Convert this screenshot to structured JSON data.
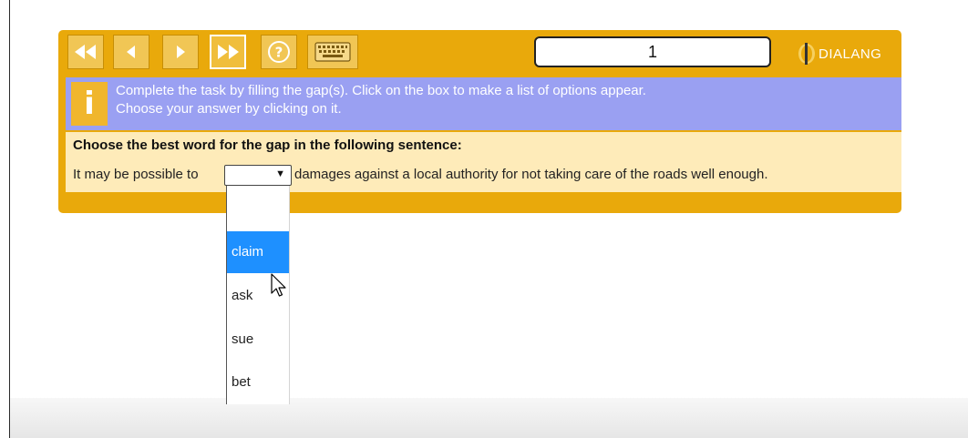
{
  "toolbar": {
    "buttons": [
      {
        "name": "first-page-icon"
      },
      {
        "name": "previous-icon"
      },
      {
        "name": "next-icon"
      },
      {
        "name": "forward-icon"
      },
      {
        "name": "help-icon",
        "glyph": "?"
      },
      {
        "name": "keyboard-icon"
      }
    ],
    "page_number": "1",
    "logo_text": "DIALANG"
  },
  "instruction": {
    "icon_glyph": "i",
    "line1": "Complete the task by filling the gap(s). Click on the box to make a list of options appear.",
    "line2": "Choose your answer by clicking on it."
  },
  "task": {
    "heading": "Choose the best word for the gap in the following sentence:",
    "sentence_before": "It may be possible to",
    "sentence_after": "damages against a local authority for not taking care of the roads well enough.",
    "select_arrow": "▼",
    "options": [
      "",
      "claim",
      "ask",
      "sue",
      "bet"
    ],
    "highlighted_option": "claim"
  },
  "colors": {
    "panel": "#e9a90b",
    "instruction_bg": "#9aa0f2",
    "task_bg": "#feebb9",
    "highlight": "#1e90ff"
  }
}
